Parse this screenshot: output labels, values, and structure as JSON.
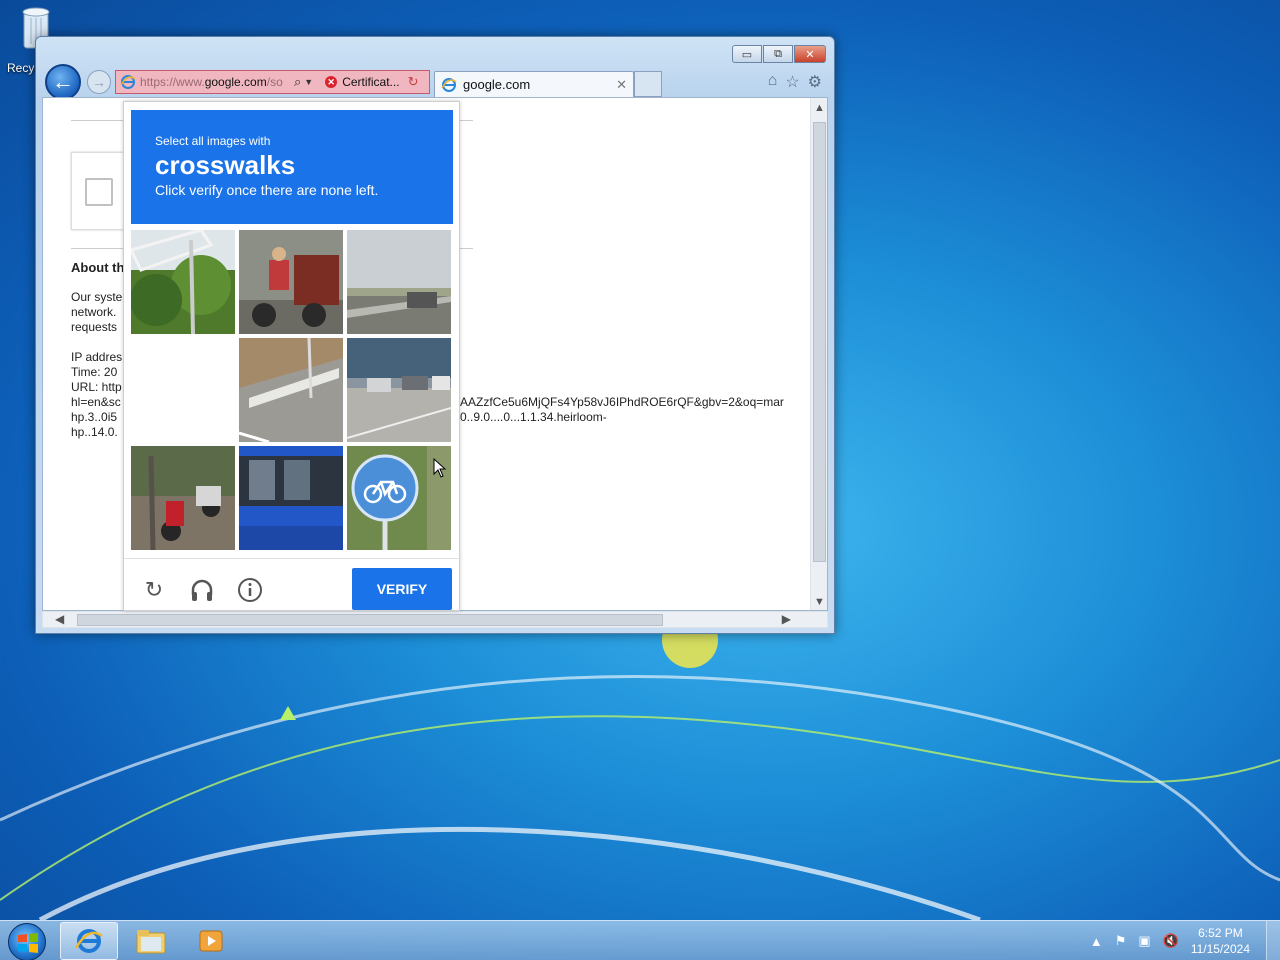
{
  "desktop": {
    "recycle_bin_label": "Recyc"
  },
  "browser": {
    "address_url_prefix": "https://www.",
    "address_url_domain": "google.com",
    "address_url_suffix": "/so",
    "certificate_label": "Certificat...",
    "tab_title": "google.com",
    "page": {
      "about_heading": "About th",
      "lines_left": [
        "Our syste",
        "network.",
        "requests"
      ],
      "info_left": [
        "IP addres",
        "Time: 20",
        "URL: http",
        "hl=en&sc",
        "hp.3..0i5",
        "hp..14.0."
      ],
      "url_continued_1": "AAZzfCe5u6MjQFs4Yp58vJ6IPhdROE6rQF&gbv=2&oq=mar",
      "url_continued_2": "0..9.0....0...1.1.34.heirloom-"
    }
  },
  "captcha": {
    "prompt_small": "Select all images with",
    "prompt_target": "crosswalks",
    "prompt_note": "Click verify once there are none left.",
    "verify_label": "VERIFY",
    "tiles": [
      "sign-gantry-trees",
      "motorcycle-cart",
      "highway-guardrail",
      "blank",
      "road-guardrail",
      "cars-parked",
      "scooter-wall",
      "blue-bus",
      "bicycle-sign"
    ]
  },
  "taskbar": {
    "time": "6:52 PM",
    "date": "11/15/2024"
  }
}
